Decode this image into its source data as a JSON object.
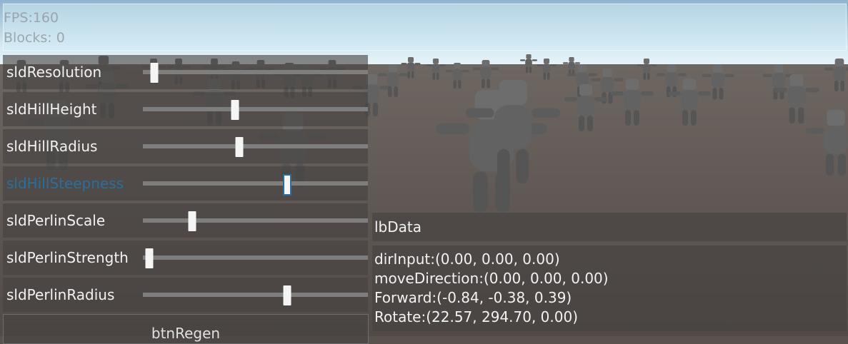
{
  "hud": {
    "fps": "FPS:160",
    "blocks": "Blocks: 0"
  },
  "sliders": [
    {
      "label": "sldResolution",
      "value": 0.05,
      "active": false
    },
    {
      "label": "sldHillHeight",
      "value": 0.41,
      "active": false
    },
    {
      "label": "sldHillRadius",
      "value": 0.43,
      "active": false
    },
    {
      "label": "sldHillSteepness",
      "value": 0.64,
      "active": true
    },
    {
      "label": "sldPerlinScale",
      "value": 0.22,
      "active": false
    },
    {
      "label": "sldPerlinStrength",
      "value": 0.03,
      "active": false
    },
    {
      "label": "sldPerlinRadius",
      "value": 0.64,
      "active": false
    }
  ],
  "button": {
    "label": "btnRegen"
  },
  "data_panel": {
    "title": "lbData",
    "lines": [
      "dirInput:(0.00, 0.00, 0.00)",
      "moveDirection:(0.00, 0.00, 0.00)",
      "Forward:(-0.84, -0.38, 0.39)",
      "Rotate:(22.57, 294.70, 0.00)"
    ]
  },
  "colors": {
    "accent": "#2a6f9a",
    "ground": "#5a524d",
    "sky": "#bcd8e4"
  }
}
